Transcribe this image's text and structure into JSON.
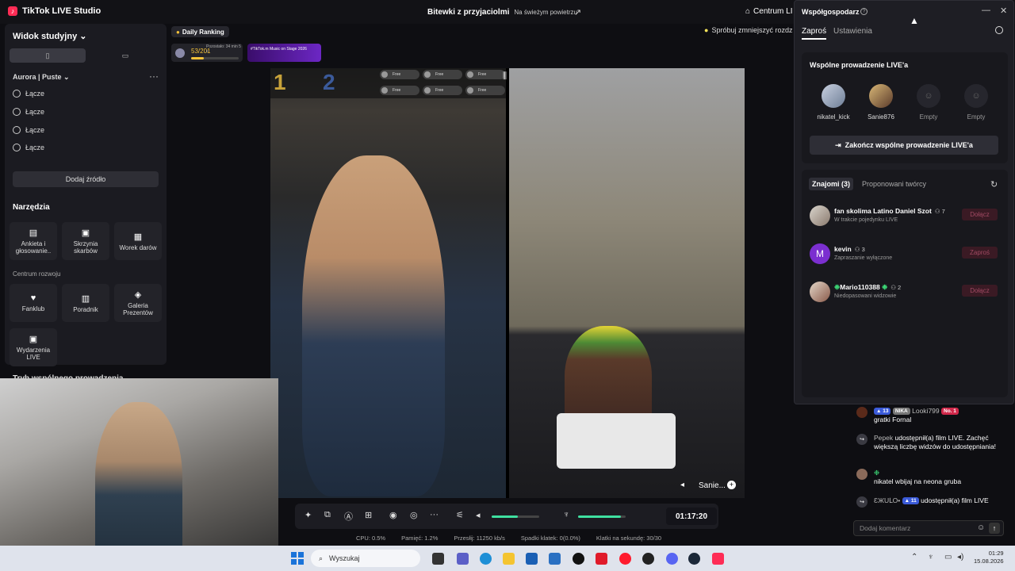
{
  "app": {
    "title": "TikTok LIVE Studio",
    "stream_title": "Bitewki z przyjaciolmi",
    "stream_subtitle": "Na świeżym powietrzu",
    "centrum": "Centrum LI"
  },
  "left_panel": {
    "title": "Widok studyjny",
    "scene_name": "Aurora | Puste",
    "sources": [
      "Łącze",
      "Łącze",
      "Łącze",
      "Łącze"
    ],
    "add_source": "Dodaj źródło",
    "tools_title": "Narzędzia",
    "tools": [
      "Ankieta i głosowanie..",
      "Skrzynia skarbów",
      "Worek darów"
    ],
    "growth_title": "Centrum rozwoju",
    "growth_tools": [
      "Fanklub",
      "Poradnik",
      "Galeria Prezentów",
      "Wydarzenia LIVE"
    ],
    "cohost_mode": "Tryb wspólnego prowadzenia"
  },
  "ranking": {
    "label": "Daily Ranking",
    "value": "53/201",
    "time_left": "Pozostało: 34 min 5 s",
    "progress": 0.26
  },
  "banner": {
    "text": "#TikTok.m Music on Stage 2026"
  },
  "tip": "Spróbuj zmniejszyć rozdz",
  "battle": {
    "score_left": "1",
    "score_right": "2",
    "slots": [
      "Free",
      "Free",
      "Free",
      "Free",
      "Free",
      "Free"
    ],
    "opponent_name": "Sanie..."
  },
  "controls": {
    "timer": "01:17:20",
    "volume_level": 0.55,
    "mic_level": 0.9
  },
  "stats": {
    "cpu": "CPU: 0.5%",
    "memory": "Pamięć: 1.2%",
    "bitrate": "Przesłij: 11250 kb/s",
    "dropped": "Spadki klatek: 0(0.0%)",
    "fps": "Klatki na sekundę: 30/30"
  },
  "cohost": {
    "title": "Współgospodarz",
    "tabs": [
      "Zaproś",
      "Ustawienia"
    ],
    "section": "Wspólne prowadzenie LIVE'a",
    "hosts": [
      "nikatel_kick",
      "Sanie876",
      "Empty",
      "Empty"
    ],
    "end_button": "Zakończ wspólne prowadzenie LIVE'a",
    "friend_tabs": [
      "Znajomi (3)",
      "Proponowani twórcy"
    ],
    "friends": [
      {
        "name": "fan skolima Latino Daniel Szot",
        "count": "7",
        "status": "W trakcie pojedynku LIVE",
        "action": "Dołącz",
        "avatar_letter": ""
      },
      {
        "name": "kevin",
        "count": "3",
        "status": "Zapraszanie wyłączone",
        "action": "Zaproś",
        "avatar_letter": "M"
      },
      {
        "name": "Mario110388",
        "count": "2",
        "status": "Niedopasowani widzowie",
        "action": "Dołącz",
        "avatar_letter": ""
      }
    ]
  },
  "chat": {
    "messages": [
      {
        "badges": [
          "13",
          "NIKA"
        ],
        "user": "Looki799",
        "extra_badge": "No. 1",
        "text": "gratki Fornal"
      },
      {
        "user": "Pepek",
        "text": "udostępnił(a) film LIVE. Zachęć większą liczbę widzów do udostępniania!"
      },
      {
        "user": "",
        "text": "nikatel wbijaj na neona gruba"
      },
      {
        "user": "ƐЖUԼO•",
        "badges": [
          "11"
        ],
        "text": "udostępnił(a) film LIVE"
      }
    ],
    "input_placeholder": "Dodaj komentarz"
  },
  "taskbar": {
    "search": "Wyszukaj",
    "time": "01:29",
    "date": "15.08.2026"
  },
  "colors": {
    "accent": "#fe2c55",
    "green": "#3ee0a0",
    "gold": "#f3c23a"
  }
}
